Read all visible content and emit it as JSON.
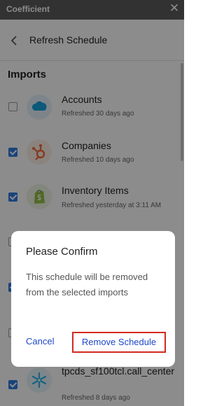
{
  "window": {
    "title": "Coefficient",
    "close_icon": "close-icon"
  },
  "header": {
    "title": "Refresh Schedule",
    "back_icon": "chevron-left-icon"
  },
  "section": {
    "title": "Imports"
  },
  "imports": [
    {
      "name": "Accounts",
      "status": "Refreshed 30 days ago",
      "checked": false,
      "icon": "salesforce-logo-icon"
    },
    {
      "name": "Companies",
      "status": "Refreshed 10 days ago",
      "checked": true,
      "icon": "hubspot-logo-icon"
    },
    {
      "name": "Inventory Items",
      "status": "Refreshed yesterday at 3:11 AM",
      "checked": true,
      "icon": "shopify-logo-icon"
    },
    {
      "name": "",
      "status": "",
      "checked": false,
      "icon": ""
    },
    {
      "name": "",
      "status": "",
      "checked": true,
      "icon": ""
    },
    {
      "name": "",
      "status": "",
      "checked": false,
      "icon": ""
    },
    {
      "name": "tpcds_sf100tcl.call_center",
      "status": "Refreshed 8 days ago",
      "checked": true,
      "icon": "snowflake-logo-icon"
    }
  ],
  "dialog": {
    "title": "Please Confirm",
    "message": "This schedule will be removed from the selected imports",
    "cancel_label": "Cancel",
    "confirm_label": "Remove Schedule"
  },
  "colors": {
    "accent": "#1f47c8",
    "checkbox_checked": "#2f7de1",
    "highlight_border": "#d32a1e",
    "titlebar": "#5b5b5b"
  }
}
